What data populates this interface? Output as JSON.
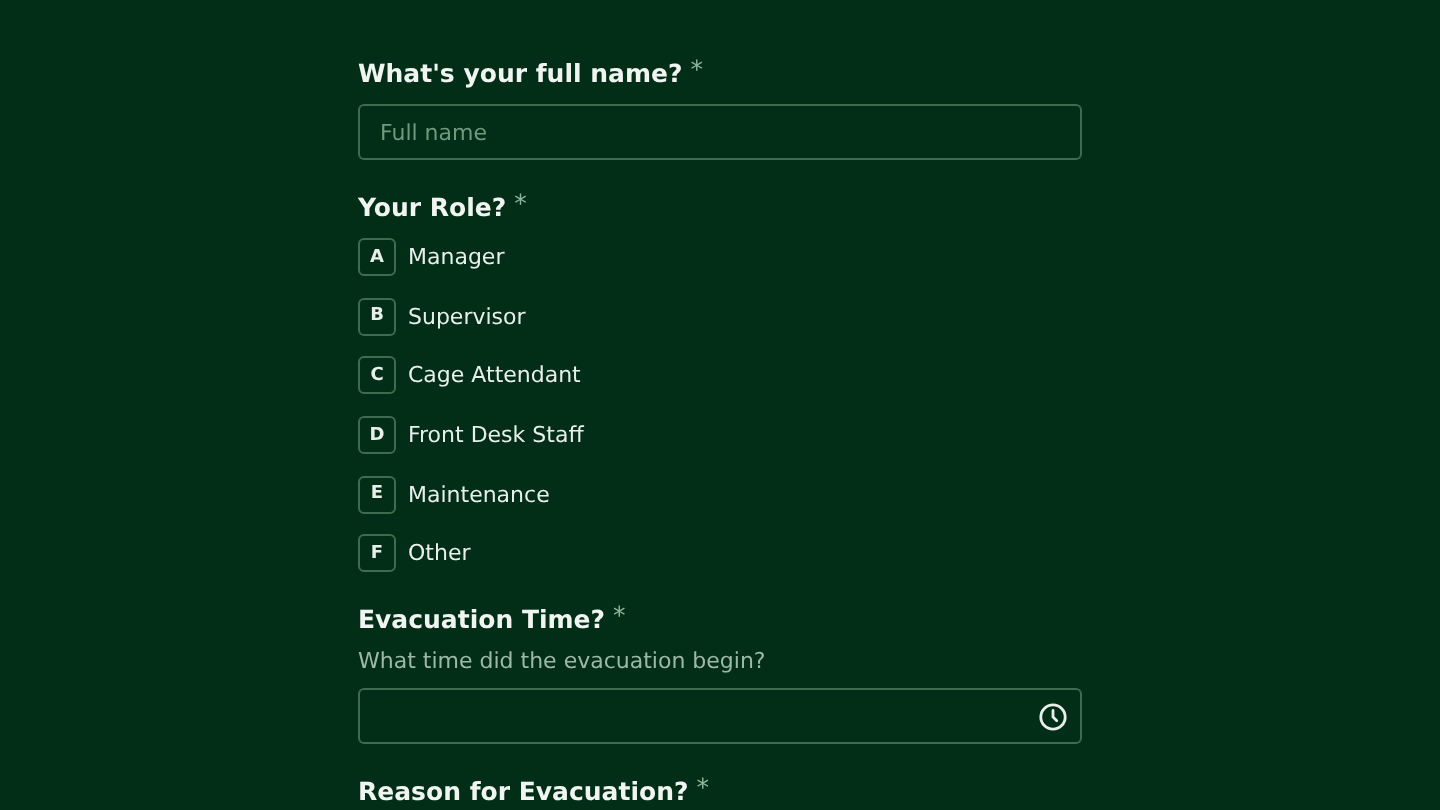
{
  "questions": [
    {
      "kind": "text",
      "label": "What's your full name?",
      "required_mark": "*",
      "placeholder": "Full name"
    },
    {
      "kind": "choice",
      "label": "Your Role?",
      "required_mark": "*",
      "options": [
        {
          "key": "A",
          "label": "Manager",
          "selected": false
        },
        {
          "key": "B",
          "label": "Supervisor",
          "selected": false
        },
        {
          "key": "C",
          "label": "Cage Attendant",
          "selected": false
        },
        {
          "key": "D",
          "label": "Front Desk Staff",
          "selected": false
        },
        {
          "key": "E",
          "label": "Maintenance",
          "selected": false
        },
        {
          "key": "F",
          "label": "Other",
          "selected": false
        }
      ]
    },
    {
      "kind": "time",
      "label": "Evacuation Time?",
      "required_mark": "*",
      "help": "What time did the evacuation begin?"
    },
    {
      "kind": "heading",
      "label": "Reason for Evacuation?",
      "required_mark": "*"
    }
  ]
}
